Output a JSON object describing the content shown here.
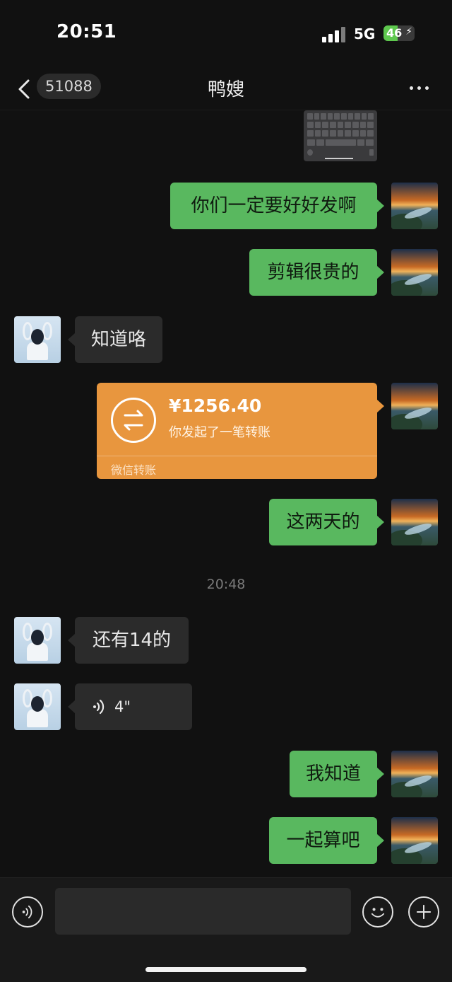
{
  "status_bar": {
    "time": "20:51",
    "network": "5G",
    "battery": "46",
    "battery_level": 0.46
  },
  "nav": {
    "unread_count": "51088",
    "title": "鸭嫂"
  },
  "messages": [
    {
      "type": "image",
      "sender": "me"
    },
    {
      "type": "text",
      "sender": "me",
      "text": "你们一定要好好发啊"
    },
    {
      "type": "text",
      "sender": "me",
      "text": "剪辑很贵的"
    },
    {
      "type": "text",
      "sender": "other",
      "text": "知道咯"
    },
    {
      "type": "transfer",
      "sender": "me",
      "amount": "¥1256.40",
      "desc": "你发起了一笔转账",
      "label": "微信转账"
    },
    {
      "type": "text",
      "sender": "me",
      "text": "这两天的"
    },
    {
      "type": "timestamp",
      "text": "20:48"
    },
    {
      "type": "text",
      "sender": "other",
      "text": "还有14的"
    },
    {
      "type": "voice",
      "sender": "other",
      "duration": "4\""
    },
    {
      "type": "text",
      "sender": "me",
      "text": "我知道"
    },
    {
      "type": "text",
      "sender": "me",
      "text": "一起算吧"
    }
  ],
  "input_bar": {
    "placeholder": "",
    "icons": [
      "voice-mode-icon",
      "emoji-icon",
      "plus-icon"
    ]
  },
  "colors": {
    "background": "#111111",
    "my_bubble": "#59b85f",
    "other_bubble": "#2b2b2b",
    "transfer": "#e8963e",
    "timestamp": "#7a7a7a"
  }
}
